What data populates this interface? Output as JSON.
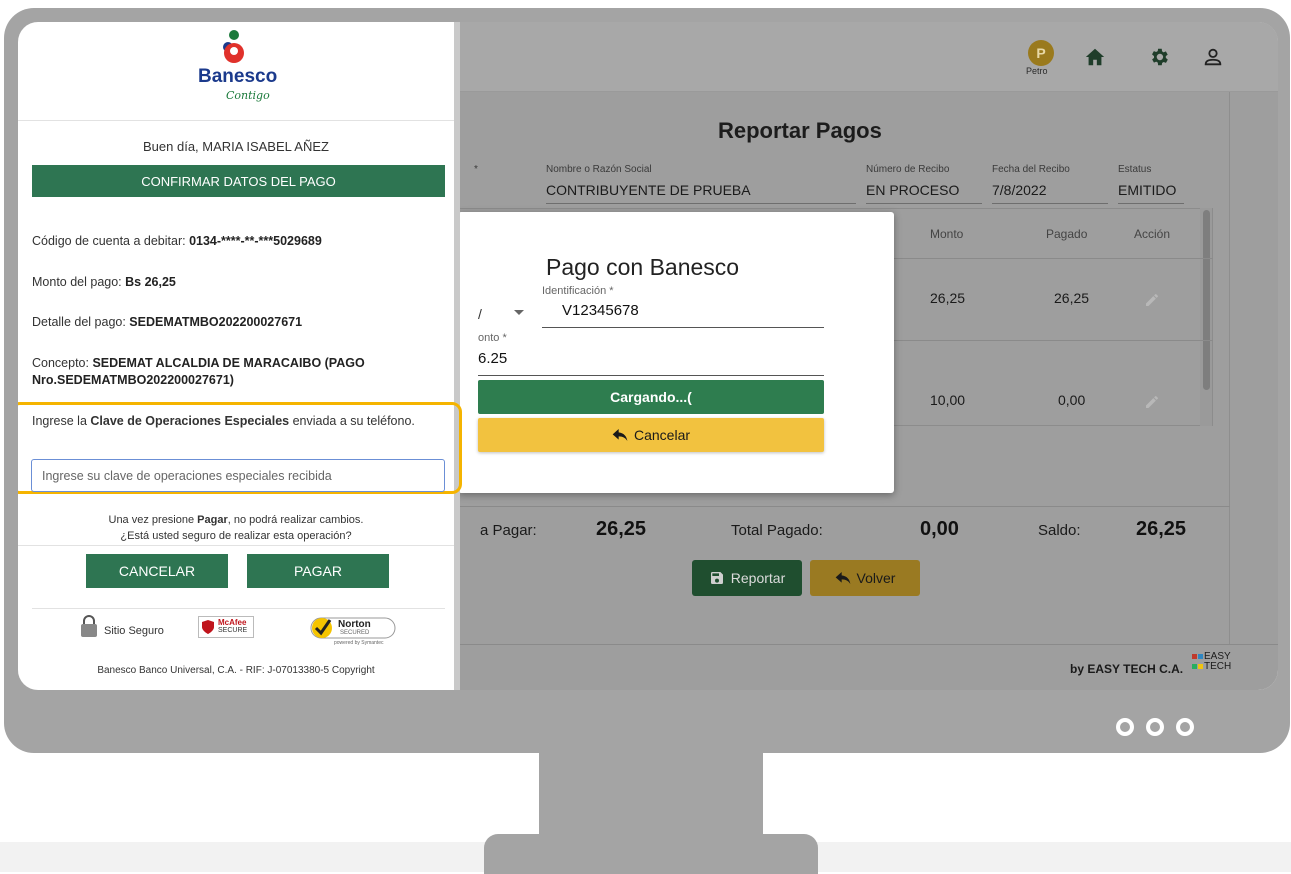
{
  "header": {
    "petro_label": "Petro",
    "petro_symbol": "P"
  },
  "report": {
    "title": "Reportar Pagos",
    "fields": [
      {
        "label": "Nombre o Razón Social",
        "value": "CONTRIBUYENTE DE PRUEBA"
      },
      {
        "label": "Número de Recibo",
        "value": "EN PROCESO"
      },
      {
        "label": "Fecha del Recibo",
        "value": "7/8/2022"
      },
      {
        "label": "Estatus",
        "value": "EMITIDO"
      }
    ],
    "partial_label_mark": "*",
    "table": {
      "headers": [
        "Monto",
        "Pagado",
        "Acción"
      ],
      "rows": [
        {
          "monto": "26,25",
          "pagado": "26,25"
        },
        {
          "monto": "10,00",
          "pagado": "0,00"
        }
      ]
    },
    "totals": {
      "a_pagar_label": "a Pagar:",
      "a_pagar_value": "26,25",
      "pagado_label": "Total Pagado:",
      "pagado_value": "0,00",
      "saldo_label": "Saldo:",
      "saldo_value": "26,25"
    },
    "reportar_label": "Reportar",
    "volver_label": "Volver",
    "footer": "by EASY TECH C.A.",
    "footer_logo": [
      "EASY",
      "TECH"
    ]
  },
  "modal": {
    "title": "Pago con Banesco",
    "id_label": "Identificación *",
    "id_value": "V12345678",
    "partial_select": "/",
    "monto_label": "onto *",
    "monto_value": "6.25",
    "loading_label": "Cargando...(",
    "cancel_label": "Cancelar"
  },
  "panel": {
    "brand": "Banesco",
    "brand_sub": "Contigo",
    "greeting": "Buen día, MARIA ISABEL AÑEZ",
    "confirm_title": "CONFIRMAR DATOS DEL PAGO",
    "cuenta_label": "Código de cuenta a debitar: ",
    "cuenta_value": "0134-****-**-***5029689",
    "monto_label": "Monto del pago: ",
    "monto_value": "Bs 26,25",
    "detalle_label": "Detalle del pago: ",
    "detalle_value": "SEDEMATMBO202200027671",
    "concepto_label": "Concepto: ",
    "concepto_line1": "SEDEMAT ALCALDIA DE MARACAIBO (PAGO",
    "concepto_line2": "Nro.SEDEMATMBO202200027671)",
    "clave_pre": "Ingrese la ",
    "clave_bold": "Clave de Operaciones Especiales",
    "clave_post": " enviada a su teléfono.",
    "clave_placeholder": "Ingrese su clave de operaciones especiales recibida",
    "warn_pre": "Una vez presione ",
    "warn_bold": "Pagar",
    "warn_post": ", no podrá realizar cambios.",
    "warn_line2": "¿Está usted seguro de realizar esta operación?",
    "cancel_button": "CANCELAR",
    "pay_button": "PAGAR",
    "secure_label": "Sitio Seguro",
    "mcafee_line1": "McAfee",
    "mcafee_line2": "SECURE",
    "norton_line1": "Norton",
    "norton_line2": "SECURED",
    "norton_line3": "powered by Symantec",
    "copyright": "Banesco Banco Universal, C.A. - RIF: J-07013380-5 Copyright"
  },
  "colors": {
    "banesco_green": "#2e7552",
    "highlight": "#f5b400",
    "cancel_yellow": "#f2c23f",
    "loading_green": "#2e7d4f"
  }
}
